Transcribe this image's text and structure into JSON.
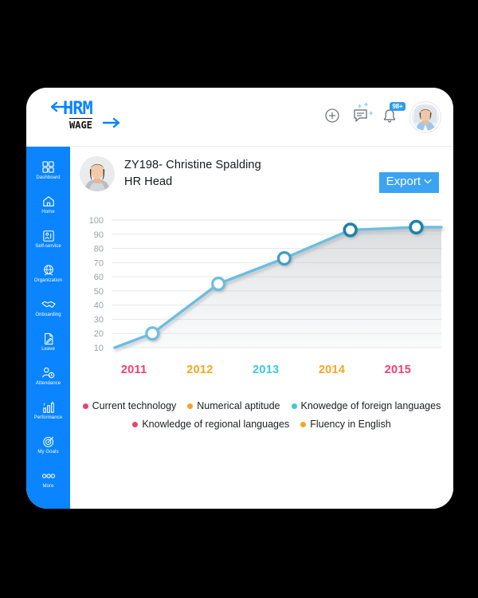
{
  "brand": {
    "logo_primary": "HRM",
    "logo_secondary": "WAGE",
    "accent_color": "#0a84ff"
  },
  "header": {
    "icons": [
      {
        "name": "add-circle-icon",
        "label": "Add"
      },
      {
        "name": "messages-icon",
        "label": "Messages"
      },
      {
        "name": "notifications-bell-icon",
        "label": "Notifications"
      }
    ],
    "notification_badge": "98+",
    "avatar_alt": "User avatar"
  },
  "sidebar": {
    "items": [
      {
        "label": "Dashboard",
        "icon": "grid-icon"
      },
      {
        "label": "Home",
        "icon": "house-icon"
      },
      {
        "label": "Self-service",
        "icon": "person-service-icon"
      },
      {
        "label": "Organization",
        "icon": "organization-icon"
      },
      {
        "label": "Onboarding",
        "icon": "handshake-icon"
      },
      {
        "label": "Leave",
        "icon": "document-pen-icon"
      },
      {
        "label": "Attendance",
        "icon": "person-clock-icon"
      },
      {
        "label": "Performance",
        "icon": "bar-chart-icon"
      },
      {
        "label": "My Goals",
        "icon": "target-icon"
      },
      {
        "label": "More",
        "icon": "more-dots-icon"
      }
    ]
  },
  "profile": {
    "name": "ZY198- Christine Spalding",
    "role": "HR Head"
  },
  "toolbar": {
    "export_label": "Export",
    "export_chevron": "⌄"
  },
  "chart_data": {
    "type": "line",
    "title": "",
    "xlabel": "",
    "ylabel": "",
    "x": [
      "2011",
      "2012",
      "2013",
      "2014",
      "2015"
    ],
    "categories": [
      "2011",
      "2012",
      "2013",
      "2014",
      "2015"
    ],
    "values": [
      20,
      55,
      73,
      93,
      95
    ],
    "series": [
      {
        "name": "Knowedge of foreign languages",
        "values": [
          20,
          55,
          73,
          93,
          95
        ],
        "color": "#6cbde4"
      }
    ],
    "ylim": [
      10,
      100
    ],
    "yticks": [
      100,
      90,
      80,
      70,
      60,
      50,
      40,
      30,
      20,
      10
    ],
    "grid": true,
    "area_fill": true,
    "legend_position": "bottom",
    "xtick_colors": [
      "#ef3f6e",
      "#f5a623",
      "#3ec6e0",
      "#f5a623",
      "#ef3f6e"
    ]
  },
  "legend": {
    "row1": [
      {
        "label": "Current technology",
        "color": "#ef3f6e"
      },
      {
        "label": "Numerical aptitude",
        "color": "#f5a623"
      },
      {
        "label": "Knowedge of foreign languages",
        "color": "#3ec6e0"
      }
    ],
    "row2": [
      {
        "label": "Knowledge of regional languages",
        "color": "#ef3f6e"
      },
      {
        "label": "Fluency in English",
        "color": "#f5a623"
      }
    ]
  }
}
